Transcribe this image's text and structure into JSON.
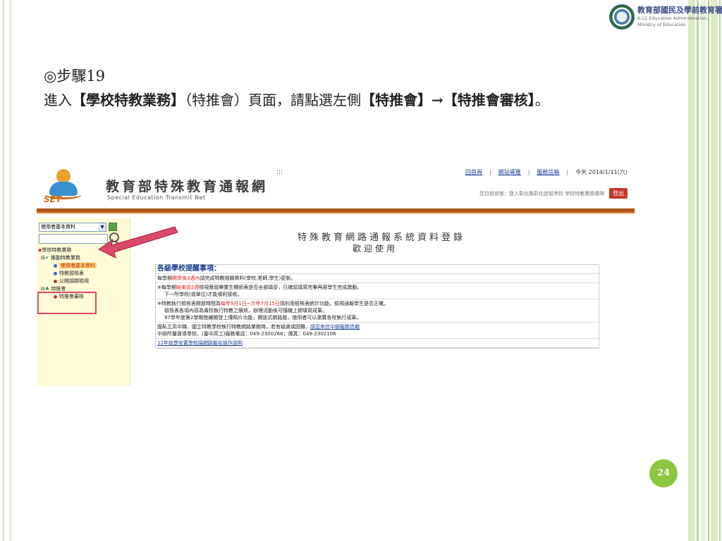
{
  "slide": {
    "step_title": "◎步驟19",
    "instruction_pre": "進入",
    "instruction_b1": "【學校特教業務】",
    "instruction_mid": "（特推會）頁面，請點選左側",
    "instruction_b2": "【特推會】→【特推會審核】",
    "instruction_post": "。",
    "page_number": "24",
    "colors": {
      "accent_green": "#8cc63f",
      "highlight": "#d84a6a"
    }
  },
  "logo": {
    "line1": "教育部國民及學前教育署",
    "line2": "K-12 Education Administration,",
    "line3": "Ministry of Education"
  },
  "site": {
    "logo_text": "SET",
    "title": "教育部特殊教育通報網",
    "subtitle": "Special Education Transmit Net",
    "dots": ":::",
    "nav": {
      "home": "回首頁",
      "sitemap": "網站導覽",
      "service": "服務信箱",
      "today": "今天 2014/1/11(六)"
    },
    "status": "您目前狀態：登入彰化縣彰化啟智學校 學校特教業務權限",
    "logout": "登出"
  },
  "sidebar": {
    "select_value": "使用者基本資料",
    "tree": [
      {
        "label": "學校特教業務",
        "level": 0
      },
      {
        "label": "推動特教業務",
        "level": 1
      },
      {
        "label": "使用者基本資料",
        "level": 2,
        "highlight": true
      },
      {
        "label": "特教檢核表",
        "level": 2
      },
      {
        "label": "公開調閱檢視",
        "level": 2
      },
      {
        "label": "特推會",
        "level": 1
      },
      {
        "label": "特推會審核",
        "level": 2
      }
    ]
  },
  "main": {
    "heading": "特殊教育網路通報系統資料登錄",
    "welcome": "歡迎使用",
    "notice_title": "各級學校提醒事項：",
    "notice": {
      "r1_a": "每學期",
      "r1_red": "開學後3週內",
      "r1_b": "請完成特教相關資料(學校,老師,學生)更新。",
      "r2_a": "※每學期",
      "r2_red": "結束前2週",
      "r2_b": "檢視應屆畢業生轉銜表是否全部填妥，已確認填寫完畢再將學生完成異動。",
      "r3": "下一所學校(或單位)才能順利接收。",
      "r4_a": "※特教執行檢核表開放時間為",
      "r4_red": "每年9月1日~次年7月15日",
      "r4_b": "請利用檢核表統計功能，檢視通報學生是否正確。",
      "r5": "檢核表各項內容為貴校執行特教之績效，辦理活動後可隨機上網填寫成果。",
      "r6": "97學年度第2學期陸續開發上傳照片功能，開放式網路版，使用者可以瀏覽各校執行成果。",
      "r7_a": "國私立高中職、國立特教學校執行特教網路業務時，若有疑慮或困難，",
      "r7_link": "請您來信中辦服務信箱",
      "r8": "中辦所屬督導學校，(臺中高工)服務電話：049-2300266；傳真：049-2302106",
      "r9_link": "12年就學安置學校端網路報名操作說明"
    }
  }
}
